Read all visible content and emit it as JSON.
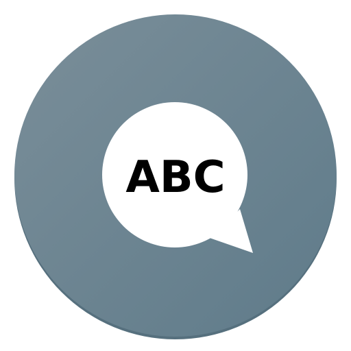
{
  "icon": {
    "name": "speech-bubble-abc-app-icon",
    "label": "ABC",
    "colors": {
      "circle_light": "#7a8e99",
      "circle_dark": "#5f7b8a",
      "circle_shadow": "#56707e",
      "bubble": "#ffffff",
      "text": "#000000"
    }
  }
}
